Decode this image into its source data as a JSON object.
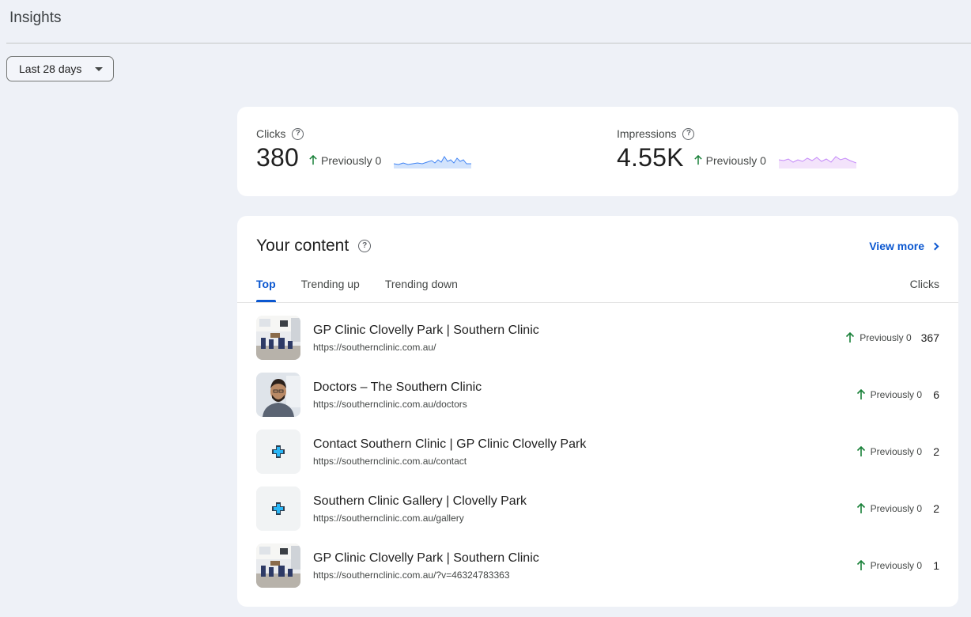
{
  "page": {
    "title": "Insights"
  },
  "date_range": {
    "selected": "Last 28 days"
  },
  "metrics": {
    "clicks": {
      "label": "Clicks",
      "value": "380",
      "previous": "Previously 0",
      "accent": "#4285f4"
    },
    "impressions": {
      "label": "Impressions",
      "value": "4.55K",
      "previous": "Previously 0",
      "accent": "#a142f4"
    }
  },
  "content": {
    "title": "Your content",
    "view_more": "View more",
    "tabs": [
      {
        "label": "Top",
        "active": true
      },
      {
        "label": "Trending up",
        "active": false
      },
      {
        "label": "Trending down",
        "active": false
      }
    ],
    "column_header": "Clicks",
    "rows": [
      {
        "title": "GP Clinic Clovelly Park | Southern Clinic",
        "url": "https://southernclinic.com.au/",
        "previous": "Previously 0",
        "value": "367",
        "thumb": "clinic-photo"
      },
      {
        "title": "Doctors – The Southern Clinic",
        "url": "https://southernclinic.com.au/doctors",
        "previous": "Previously 0",
        "value": "6",
        "thumb": "doctor-photo"
      },
      {
        "title": "Contact Southern Clinic | GP Clinic Clovelly Park",
        "url": "https://southernclinic.com.au/contact",
        "previous": "Previously 0",
        "value": "2",
        "thumb": "medical-cross-icon"
      },
      {
        "title": "Southern Clinic Gallery | Clovelly Park",
        "url": "https://southernclinic.com.au/gallery",
        "previous": "Previously 0",
        "value": "2",
        "thumb": "medical-cross-icon"
      },
      {
        "title": "GP Clinic Clovelly Park | Southern Clinic",
        "url": "https://southernclinic.com.au/?v=46324783363",
        "previous": "Previously 0",
        "value": "1",
        "thumb": "clinic-photo"
      }
    ]
  },
  "colors": {
    "accent_blue": "#0b57d0",
    "trend_up": "#188038",
    "background": "#eef1f7"
  }
}
